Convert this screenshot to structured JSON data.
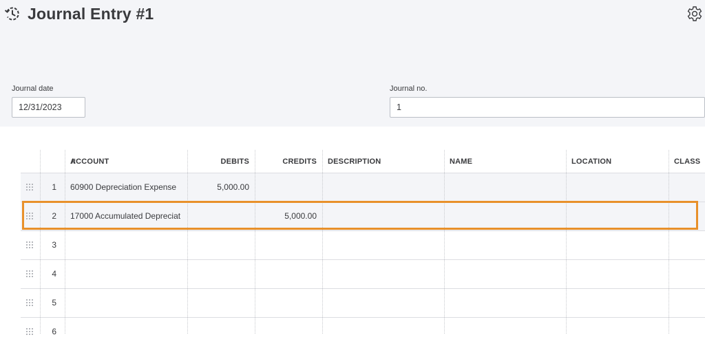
{
  "header": {
    "title": "Journal Entry #1",
    "history_icon": "history-clock-icon",
    "settings_icon": "gear-icon"
  },
  "form": {
    "journal_date_label": "Journal date",
    "journal_date_value": "12/31/2023",
    "journal_no_label": "Journal no.",
    "journal_no_value": "1"
  },
  "table": {
    "columns": [
      "#",
      "ACCOUNT",
      "DEBITS",
      "CREDITS",
      "DESCRIPTION",
      "NAME",
      "LOCATION",
      "CLASS"
    ],
    "rows": [
      {
        "num": "1",
        "account": "60900 Depreciation Expense",
        "debits": "5,000.00",
        "credits": "",
        "description": "",
        "name": "",
        "location": "",
        "class": ""
      },
      {
        "num": "2",
        "account": "17000 Accumulated Depreciat",
        "debits": "",
        "credits": "5,000.00",
        "description": "",
        "name": "",
        "location": "",
        "class": ""
      },
      {
        "num": "3",
        "account": "",
        "debits": "",
        "credits": "",
        "description": "",
        "name": "",
        "location": "",
        "class": ""
      },
      {
        "num": "4",
        "account": "",
        "debits": "",
        "credits": "",
        "description": "",
        "name": "",
        "location": "",
        "class": ""
      },
      {
        "num": "5",
        "account": "",
        "debits": "",
        "credits": "",
        "description": "",
        "name": "",
        "location": "",
        "class": ""
      },
      {
        "num": "6",
        "account": "",
        "debits": "",
        "credits": "",
        "description": "",
        "name": "",
        "location": "",
        "class": ""
      }
    ]
  },
  "colors": {
    "background_top": "#f4f5f8",
    "text": "#393a3d",
    "highlight": "#e8902a"
  }
}
